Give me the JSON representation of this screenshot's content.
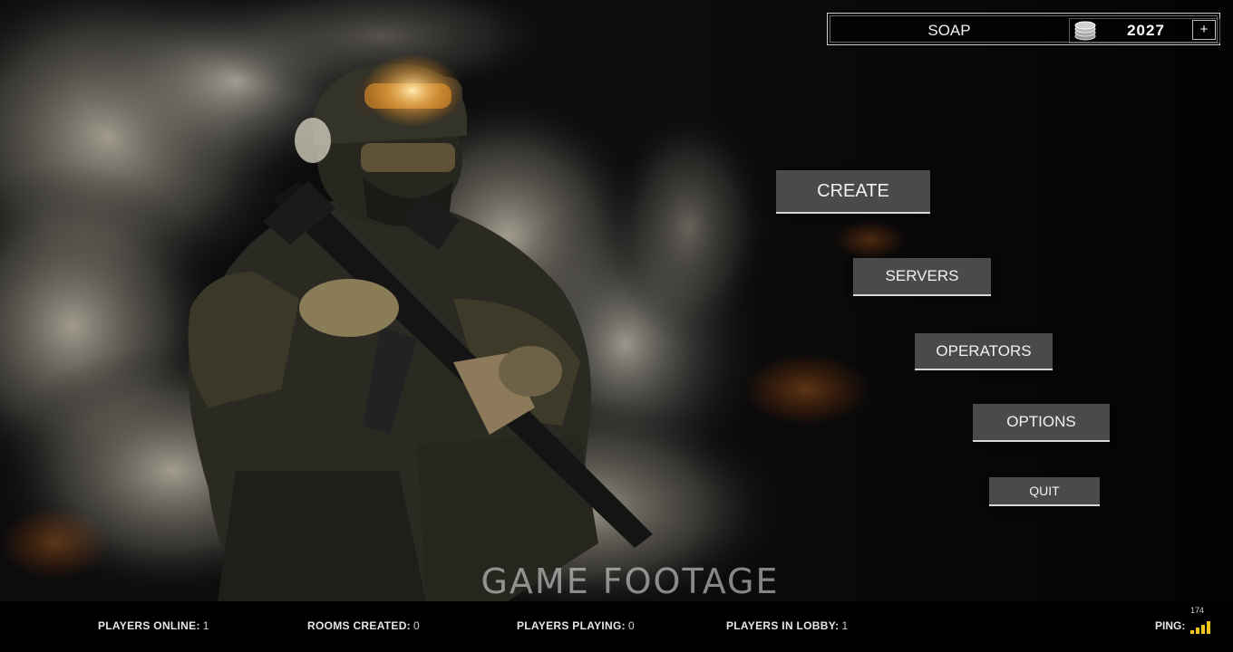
{
  "profile": {
    "player_name": "SOAP",
    "currency_value": "2027",
    "add_label": "+"
  },
  "menu": {
    "create": "CREATE",
    "servers": "SERVERS",
    "operators": "OPERATORS",
    "options": "OPTIONS",
    "quit": "QUIT"
  },
  "watermark": "GAME FOOTAGE",
  "status": {
    "players_online_label": "PLAYERS ONLINE:",
    "players_online": "1",
    "rooms_created_label": "ROOMS CREATED:",
    "rooms_created": "0",
    "players_playing_label": "PLAYERS PLAYING:",
    "players_playing": "0",
    "players_in_lobby_label": "PLAYERS IN LOBBY:",
    "players_in_lobby": "1",
    "ping_label": "PING:",
    "ping_value": "174"
  },
  "icons": {
    "currency": "coin-stack-icon",
    "ping": "signal-bars-icon"
  },
  "colors": {
    "button_bg": "#4a4a4a",
    "button_underline": "#d8d8d8",
    "signal": "#f0c419",
    "background": "#0a0a0b"
  }
}
